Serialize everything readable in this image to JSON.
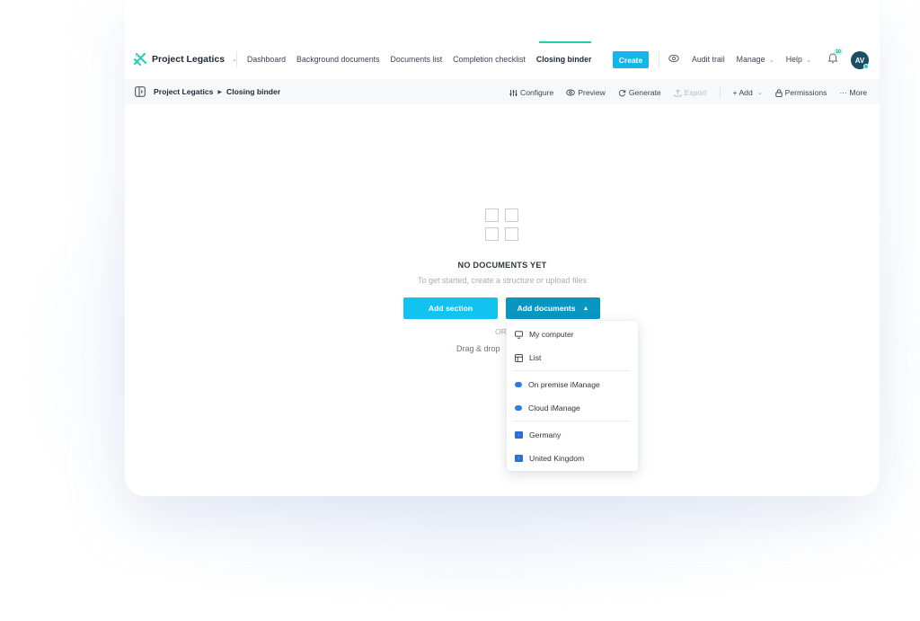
{
  "app": {
    "project_name": "Project Legatics",
    "colors": {
      "accent": "#12b6e8",
      "accent_dark": "#0a96c2",
      "teal": "#1fd0b5"
    }
  },
  "nav": {
    "items": [
      "Dashboard",
      "Background documents",
      "Documents list",
      "Completion checklist",
      "Closing binder"
    ],
    "active": "Closing binder",
    "create_label": "Create",
    "audit_trail": "Audit trail",
    "manage": "Manage",
    "help": "Help",
    "notification_count": "10",
    "avatar_initials": "AV"
  },
  "breadcrumb": {
    "project": "Project Legatics",
    "page": "Closing binder"
  },
  "toolbar": {
    "configure": "Configure",
    "preview": "Preview",
    "generate": "Generate",
    "export": "Export",
    "add": "+ Add",
    "permissions": "Permissions",
    "more": "··· More"
  },
  "empty_state": {
    "title": "NO DOCUMENTS YET",
    "subtitle": "To get started, create a structure or upload files",
    "add_section": "Add section",
    "add_documents": "Add documents",
    "or": "OR",
    "drag_drop": "Drag & drop"
  },
  "dropdown": {
    "items": [
      {
        "label": "My computer",
        "icon": "monitor-icon"
      },
      {
        "label": "List",
        "icon": "table-icon"
      },
      {
        "label": "On premise iManage",
        "icon": "cloud-icon"
      },
      {
        "label": "Cloud iManage",
        "icon": "cloud-icon"
      },
      {
        "label": "Germany",
        "icon": "flag-icon"
      },
      {
        "label": "United Kingdom",
        "icon": "flag-icon"
      }
    ]
  }
}
